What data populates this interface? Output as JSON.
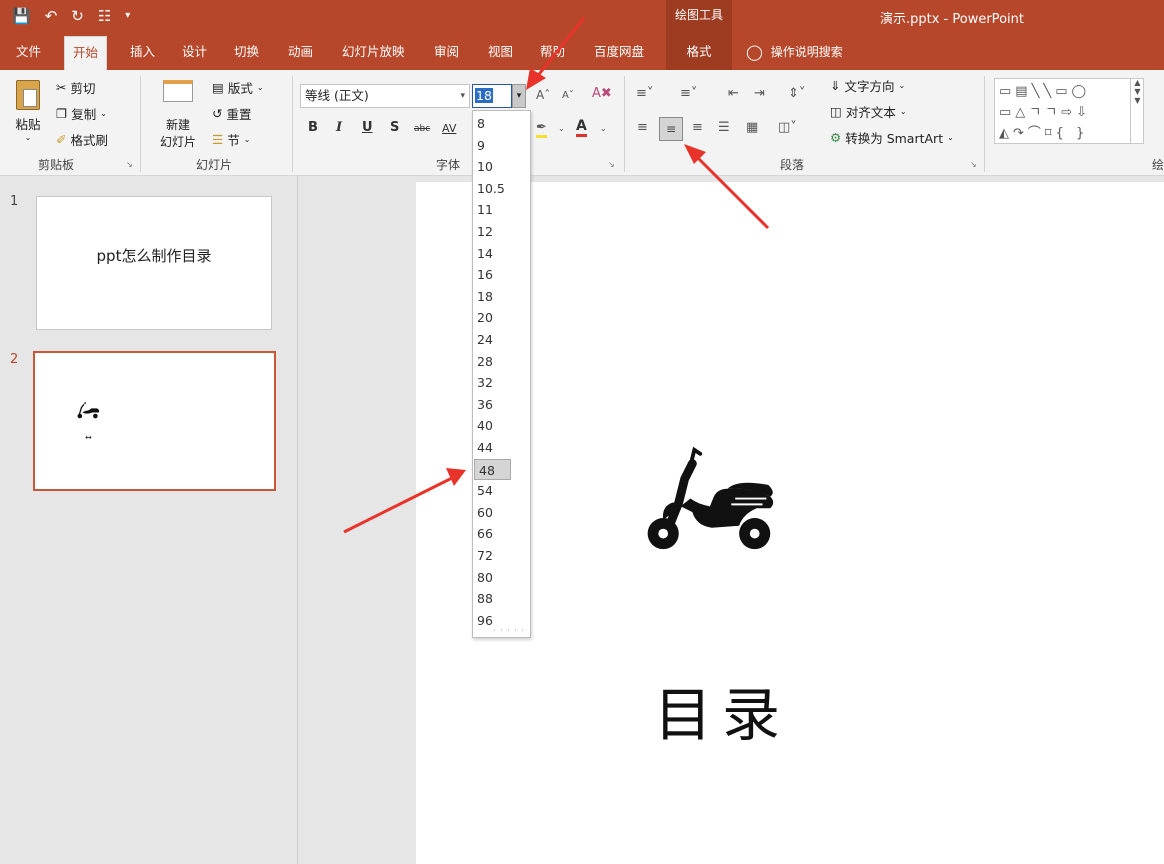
{
  "titlebar": {
    "qat_icons": [
      "save-icon",
      "undo-icon",
      "redo-icon",
      "present-icon",
      "customize-icon"
    ],
    "contextual_tab_group": "绘图工具",
    "document_title": "演示.pptx  -  PowerPoint"
  },
  "tabs": [
    {
      "label": "文件"
    },
    {
      "label": "开始"
    },
    {
      "label": "插入"
    },
    {
      "label": "设计"
    },
    {
      "label": "切换"
    },
    {
      "label": "动画"
    },
    {
      "label": "幻灯片放映"
    },
    {
      "label": "审阅"
    },
    {
      "label": "视图"
    },
    {
      "label": "帮助"
    },
    {
      "label": "百度网盘"
    },
    {
      "label": "格式"
    }
  ],
  "tell_me": "操作说明搜索",
  "ribbon": {
    "clipboard": {
      "paste": "粘贴",
      "cut": "剪切",
      "copy": "复制",
      "format_painter": "格式刷",
      "label": "剪贴板"
    },
    "slides": {
      "new_slide_line1": "新建",
      "new_slide_line2": "幻灯片",
      "layout": "版式",
      "reset": "重置",
      "section": "节",
      "label": "幻灯片"
    },
    "font": {
      "font_name": "等线 (正文)",
      "font_size": "18",
      "bold": "B",
      "italic": "I",
      "underline": "U",
      "shadow": "S",
      "strikethrough": "abc",
      "spacing": "AV",
      "label": "字体"
    },
    "paragraph": {
      "text_direction": "文字方向",
      "align_text": "对齐文本",
      "convert_smartart": "转换为 SmartArt",
      "label": "段落"
    },
    "drawing": {
      "label": "绘"
    }
  },
  "font_size_list": [
    "8",
    "9",
    "10",
    "10.5",
    "11",
    "12",
    "14",
    "16",
    "18",
    "20",
    "24",
    "28",
    "32",
    "36",
    "40",
    "44",
    "48",
    "54",
    "60",
    "66",
    "72",
    "80",
    "88",
    "96"
  ],
  "font_size_hovered": "48",
  "thumbnails": [
    {
      "number": "1",
      "text": "ppt怎么制作目录"
    },
    {
      "number": "2",
      "text": ""
    }
  ],
  "slide": {
    "title": "目录",
    "image": "scooter-icon"
  },
  "colors": {
    "accent": "#b7472a",
    "annotation_arrow": "#e8332a"
  }
}
